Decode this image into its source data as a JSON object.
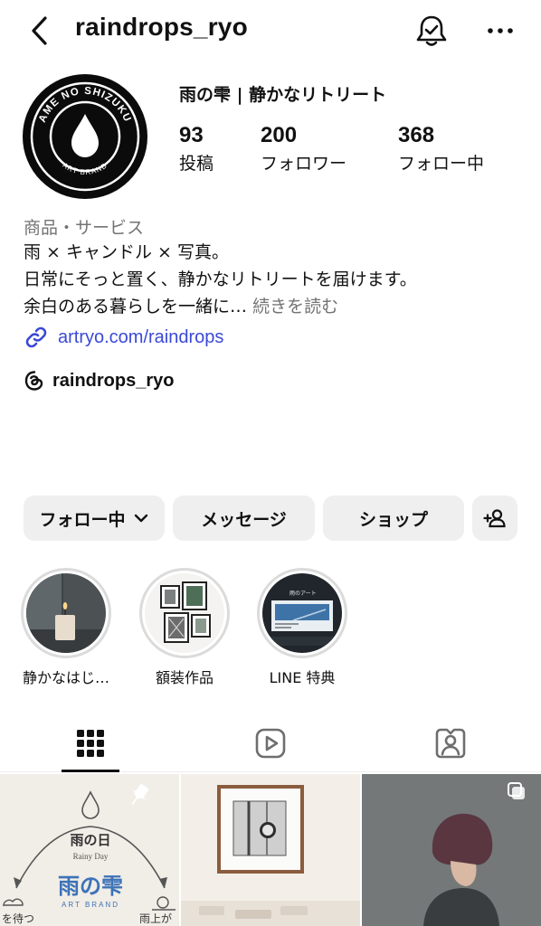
{
  "header": {
    "username": "raindrops_ryo"
  },
  "profile": {
    "display_name": "雨の雫 | 静かなリトリート",
    "avatar": {
      "ring_text": "AME NO SHIZUKU",
      "sub_text": "ART BRAND"
    },
    "stats": [
      {
        "value": "93",
        "label": "投稿"
      },
      {
        "value": "200",
        "label": "フォロワー"
      },
      {
        "value": "368",
        "label": "フォロー中"
      }
    ],
    "category": "商品・サービス",
    "bio_lines": [
      "雨 × キャンドル × 写真。",
      "日常にそっと置く、静かなリトリートを届けます。",
      "余白のある暮らしを一緒に…"
    ],
    "bio_more": "続きを読む",
    "link": "artryo.com/raindrops",
    "threads_handle": "raindrops_ryo"
  },
  "actions": {
    "following": "フォロー中",
    "message": "メッセージ",
    "shop": "ショップ"
  },
  "highlights": [
    {
      "label": "静かなはじ…"
    },
    {
      "label": "額装作品"
    },
    {
      "label": "LINE 特典"
    }
  ],
  "highlight_art": {
    "line_card_title": "雨のアート"
  },
  "post1": {
    "title": "雨の日",
    "subtitle": "Rainy Day",
    "brand": "雨の雫",
    "brand_sub": "ART BRAND",
    "left_text": "を待つ",
    "right_text": "雨上が"
  },
  "tabs": [
    "grid-icon",
    "reels-icon",
    "tagged-icon"
  ],
  "colors": {
    "link": "#3a49d6",
    "button_bg": "#efefef",
    "secondary_text": "#737373",
    "post_brand": "#3c73b8"
  }
}
